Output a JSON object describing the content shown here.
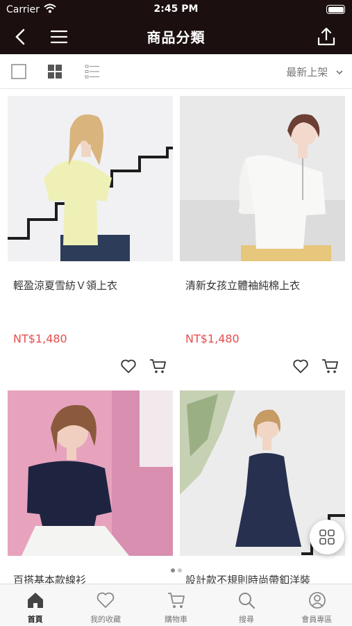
{
  "status_bar": {
    "carrier": "Carrier",
    "time": "2:45 PM"
  },
  "nav": {
    "title": "商品分類",
    "back_icon": "chevron-left-icon",
    "menu_icon": "hamburger-icon",
    "share_icon": "share-icon"
  },
  "toolbar": {
    "sort_label": "最新上架",
    "views": [
      "single-view",
      "grid-view",
      "list-view"
    ]
  },
  "products": [
    {
      "name": "輕盈涼夏雪紡Ｖ領上衣",
      "price": "NT$1,480"
    },
    {
      "name": "清新女孩立體袖純棉上衣",
      "price": "NT$1,480"
    },
    {
      "name": "百搭基本款線衫",
      "price": ""
    },
    {
      "name": "設計款不規則時尚帶釦洋裝",
      "price": ""
    }
  ],
  "pager": {
    "total": 2,
    "active": 1
  },
  "tabs": [
    {
      "label": "首頁",
      "icon": "home-icon",
      "active": true
    },
    {
      "label": "我的收藏",
      "icon": "heart-icon",
      "active": false
    },
    {
      "label": "購物車",
      "icon": "cart-icon",
      "active": false
    },
    {
      "label": "搜尋",
      "icon": "search-icon",
      "active": false
    },
    {
      "label": "會員專區",
      "icon": "user-icon",
      "active": false
    }
  ],
  "colors": {
    "header_bg": "#1b0f0f",
    "price": "#e74c4c"
  }
}
